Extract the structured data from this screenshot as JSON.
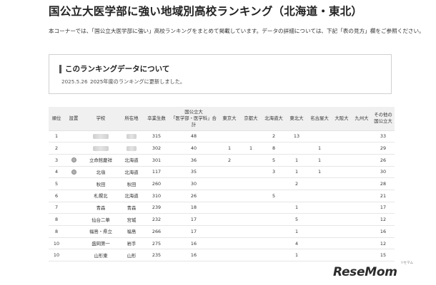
{
  "page": {
    "title": "国公立大医学部に強い地域別高校ランキング（北海道・東北）",
    "intro": "本コーナーでは、「国公立大医学部に強い」高校ランキングをまとめて掲載しています。データの詳細については、下記「表の見方」欄をご参照ください。"
  },
  "notice": {
    "heading": "このランキングデータについて",
    "date": "2025.5.26",
    "message": "2025年度のランキングに更新しました。"
  },
  "table": {
    "headers": [
      "順位",
      "設置",
      "学校",
      "所在地",
      "卒業生数",
      "国公立大\n「医学部・医学科」合計",
      "東京大",
      "京都大",
      "北海道大",
      "東北大",
      "名古屋大",
      "大阪大",
      "九州大",
      "その他の\n国公立大"
    ],
    "rows": [
      {
        "rank": "1",
        "type": "",
        "school": "",
        "location": "",
        "grads": "315",
        "total": "48",
        "tokyo": "",
        "kyoto": "",
        "hokkaido": "2",
        "tohoku": "13",
        "nagoya": "",
        "osaka": "",
        "kyushu": "",
        "other": "33"
      },
      {
        "rank": "2",
        "type": "",
        "school": "",
        "location": "",
        "grads": "302",
        "total": "40",
        "tokyo": "1",
        "kyoto": "1",
        "hokkaido": "8",
        "tohoku": "",
        "nagoya": "1",
        "osaka": "",
        "kyushu": "",
        "other": "29"
      },
      {
        "rank": "3",
        "type": "",
        "school": "立命館慶祥",
        "location": "北海道",
        "grads": "301",
        "total": "36",
        "tokyo": "2",
        "kyoto": "",
        "hokkaido": "5",
        "tohoku": "1",
        "nagoya": "1",
        "osaka": "",
        "kyushu": "",
        "other": "26"
      },
      {
        "rank": "4",
        "type": "",
        "school": "北嶺",
        "location": "北海道",
        "grads": "117",
        "total": "35",
        "tokyo": "",
        "kyoto": "",
        "hokkaido": "3",
        "tohoku": "1",
        "nagoya": "1",
        "osaka": "",
        "kyushu": "",
        "other": "30"
      },
      {
        "rank": "5",
        "type": "",
        "school": "秋田",
        "location": "秋田",
        "grads": "260",
        "total": "30",
        "tokyo": "",
        "kyoto": "",
        "hokkaido": "",
        "tohoku": "2",
        "nagoya": "",
        "osaka": "",
        "kyushu": "",
        "other": "28"
      },
      {
        "rank": "6",
        "type": "",
        "school": "札幌北",
        "location": "北海道",
        "grads": "310",
        "total": "26",
        "tokyo": "",
        "kyoto": "",
        "hokkaido": "5",
        "tohoku": "",
        "nagoya": "",
        "osaka": "",
        "kyushu": "",
        "other": "21"
      },
      {
        "rank": "7",
        "type": "",
        "school": "青森",
        "location": "青森",
        "grads": "239",
        "total": "18",
        "tokyo": "",
        "kyoto": "",
        "hokkaido": "",
        "tohoku": "1",
        "nagoya": "",
        "osaka": "",
        "kyushu": "",
        "other": "17"
      },
      {
        "rank": "8",
        "type": "",
        "school": "仙台二華",
        "location": "宮城",
        "grads": "232",
        "total": "17",
        "tokyo": "",
        "kyoto": "",
        "hokkaido": "",
        "tohoku": "5",
        "nagoya": "",
        "osaka": "",
        "kyushu": "",
        "other": "12"
      },
      {
        "rank": "8",
        "type": "",
        "school": "福島・県立",
        "location": "福島",
        "grads": "266",
        "total": "17",
        "tokyo": "",
        "kyoto": "",
        "hokkaido": "",
        "tohoku": "1",
        "nagoya": "",
        "osaka": "",
        "kyushu": "",
        "other": "16"
      },
      {
        "rank": "10",
        "type": "",
        "school": "盛岡第一",
        "location": "岩手",
        "grads": "275",
        "total": "16",
        "tokyo": "",
        "kyoto": "",
        "hokkaido": "",
        "tohoku": "4",
        "nagoya": "",
        "osaka": "",
        "kyushu": "",
        "other": "12"
      },
      {
        "rank": "10",
        "type": "",
        "school": "山形東",
        "location": "山形",
        "grads": "235",
        "total": "16",
        "tokyo": "",
        "kyoto": "",
        "hokkaido": "",
        "tohoku": "1",
        "nagoya": "",
        "osaka": "",
        "kyushu": "",
        "other": "15"
      }
    ]
  },
  "branding": {
    "logo": "ReseMom",
    "logo_sub": "リセマム"
  },
  "colors": {
    "header_bg": "#f0f0f0",
    "border": "#d0d0d0",
    "accent_bar": "#555555"
  }
}
